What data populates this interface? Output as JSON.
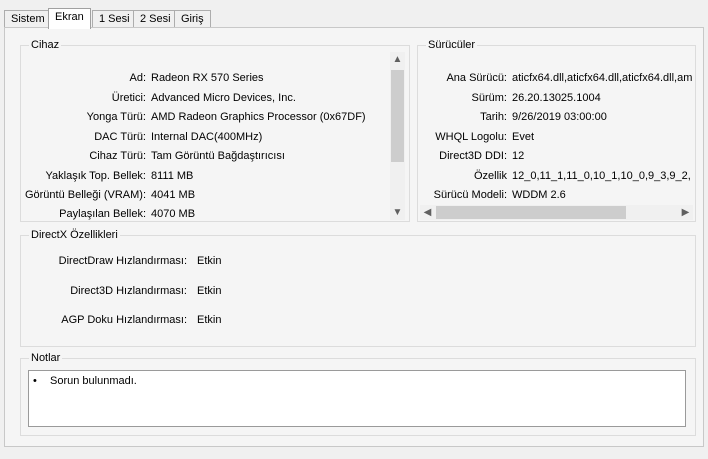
{
  "tabs": [
    {
      "label": "Sistem"
    },
    {
      "label": "Ekran"
    },
    {
      "label": "1 Sesi"
    },
    {
      "label": "2 Sesi"
    },
    {
      "label": "Giriş"
    }
  ],
  "device": {
    "title": "Cihaz",
    "rows": [
      {
        "label": "Ad:",
        "value": "Radeon RX 570 Series"
      },
      {
        "label": "Üretici:",
        "value": "Advanced Micro Devices, Inc."
      },
      {
        "label": "Yonga Türü:",
        "value": "AMD Radeon Graphics Processor (0x67DF)"
      },
      {
        "label": "DAC Türü:",
        "value": "Internal DAC(400MHz)"
      },
      {
        "label": "Cihaz Türü:",
        "value": "Tam Görüntü Bağdaştırıcısı"
      },
      {
        "label": "Yaklaşık Top. Bellek:",
        "value": "8111 MB"
      },
      {
        "label": "Görüntü Belleği (VRAM):",
        "value": "4041 MB"
      },
      {
        "label": "Paylaşılan Bellek:",
        "value": "4070 MB"
      }
    ]
  },
  "drivers": {
    "title": "Sürücüler",
    "rows": [
      {
        "label": "Ana Sürücü:",
        "value": "aticfx64.dll,aticfx64.dll,aticfx64.dll,am"
      },
      {
        "label": "Sürüm:",
        "value": "26.20.13025.1004"
      },
      {
        "label": "Tarih:",
        "value": "9/26/2019 03:00:00"
      },
      {
        "label": "WHQL Logolu:",
        "value": "Evet"
      },
      {
        "label": "Direct3D DDI:",
        "value": "12"
      },
      {
        "label": "Özellik",
        "value": "12_0,11_1,11_0,10_1,10_0,9_3,9_2,"
      },
      {
        "label": "Sürücü Modeli:",
        "value": "WDDM 2.6"
      }
    ]
  },
  "directx": {
    "title": "DirectX Özellikleri",
    "rows": [
      {
        "label": "DirectDraw Hızlandırması:",
        "value": "Etkin"
      },
      {
        "label": "Direct3D Hızlandırması:",
        "value": "Etkin"
      },
      {
        "label": "AGP Doku Hızlandırması:",
        "value": "Etkin"
      }
    ]
  },
  "notes": {
    "title": "Notlar",
    "items": [
      "Sorun bulunmadı."
    ]
  }
}
